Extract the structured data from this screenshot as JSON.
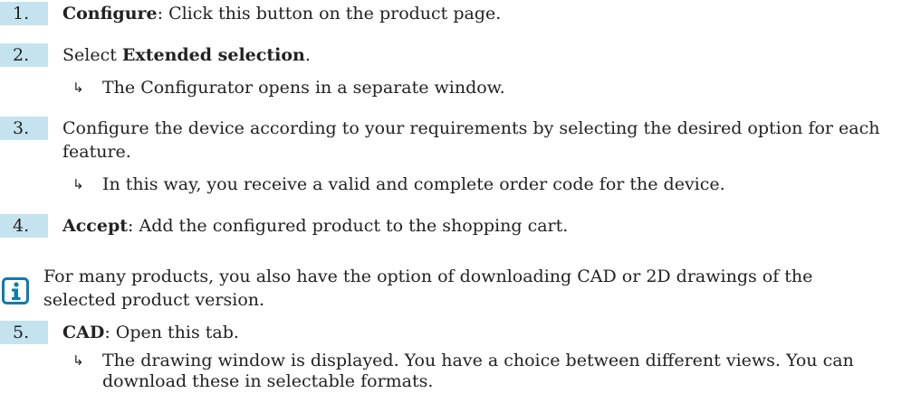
{
  "steps": [
    {
      "number": "1.",
      "label": "Configure",
      "text": ": Click this button on the product page."
    },
    {
      "number": "2.",
      "prefix": "Select ",
      "label": "Extended selection",
      "suffix": ".",
      "result": "The Configurator opens in a separate window."
    },
    {
      "number": "3.",
      "text_line1": "Configure the device according to your requirements by selecting the desired option for each",
      "text_line2": "feature.",
      "result": "In this way, you receive a valid and complete order code for the device."
    },
    {
      "number": "4.",
      "label": "Accept",
      "text": ": Add the configured product to the shopping cart."
    },
    {
      "number": "5.",
      "label": "CAD",
      "text": ": Open this tab.",
      "result_line1": "The drawing window is displayed. You have a choice between different views. You can",
      "result_line2": "download these in selectable formats."
    }
  ],
  "note": {
    "icon": "info-icon",
    "line1": "For many products, you also have the option of downloading CAD or 2D drawings of the",
    "line2": "selected product version."
  },
  "colors": {
    "step_number_background": "#c5e3ef",
    "info_icon_color": "#0a7cb0"
  }
}
